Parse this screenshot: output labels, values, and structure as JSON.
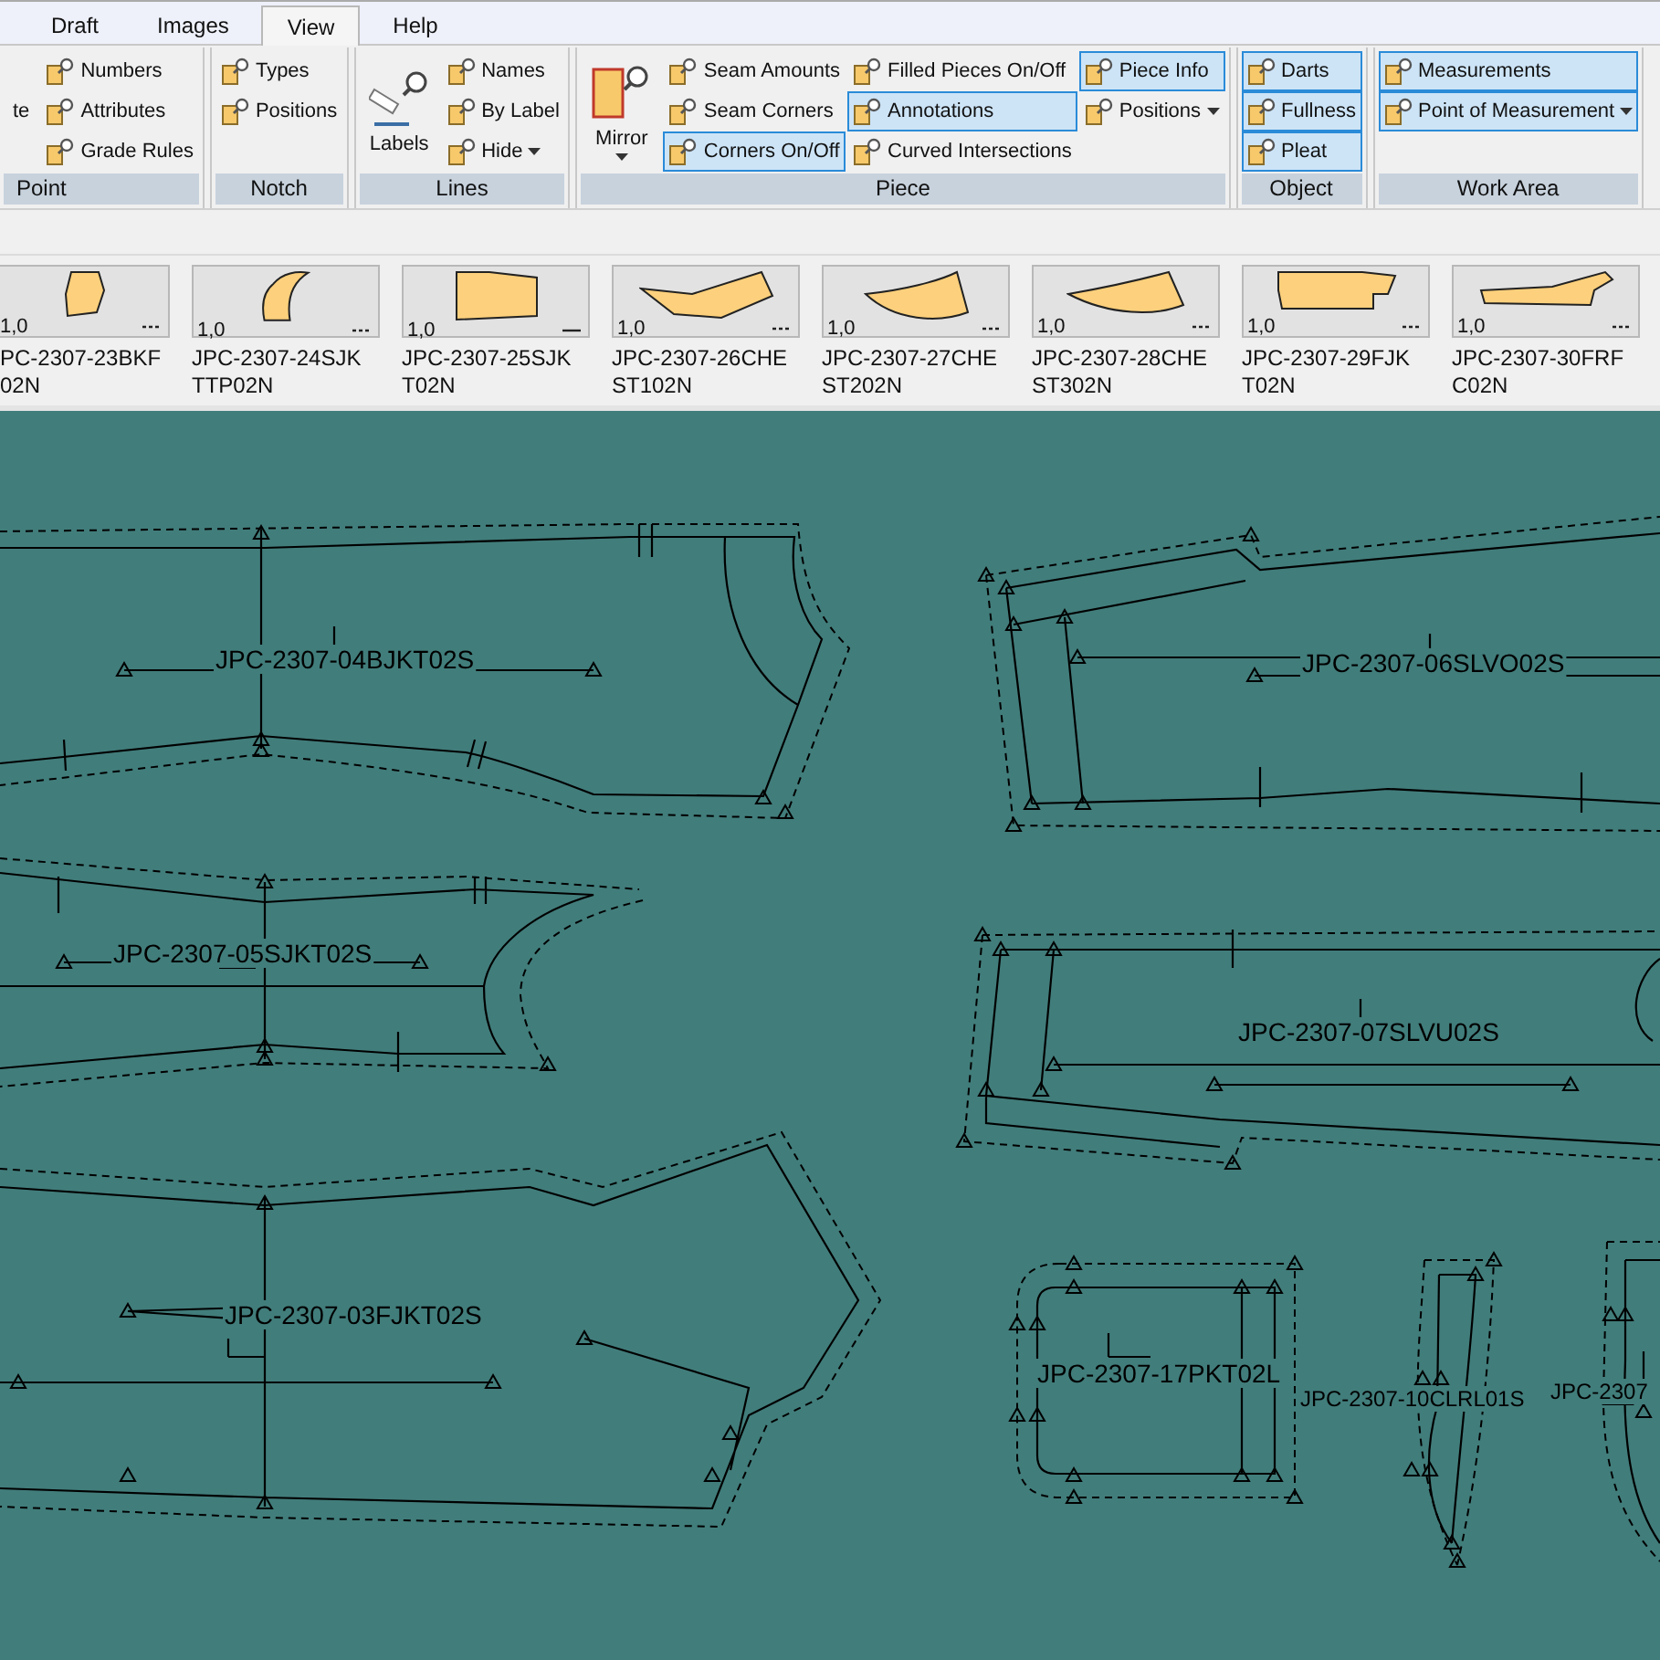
{
  "tabs": [
    {
      "label": "Draft",
      "selected": false
    },
    {
      "label": "Images",
      "selected": false
    },
    {
      "label": "View",
      "selected": true
    },
    {
      "label": "Help",
      "selected": false
    }
  ],
  "ribbon": {
    "groups": [
      {
        "title": "Point",
        "large": [
          {
            "label": "te",
            "kind": "text"
          }
        ],
        "columns": [
          [
            {
              "label": "Numbers",
              "kind": "button",
              "selected": false
            },
            {
              "label": "Attributes",
              "kind": "button",
              "selected": false
            },
            {
              "label": "Grade Rules",
              "kind": "button",
              "selected": false
            }
          ]
        ]
      },
      {
        "title": "Notch",
        "columns": [
          [
            {
              "label": "Types",
              "kind": "button",
              "selected": false
            },
            {
              "label": "Positions",
              "kind": "button",
              "selected": false
            }
          ]
        ]
      },
      {
        "title": "Lines",
        "large": [
          {
            "label": "Labels",
            "kind": "button"
          }
        ],
        "columns": [
          [
            {
              "label": "Names",
              "kind": "button",
              "selected": false
            },
            {
              "label": "By Label",
              "kind": "button",
              "selected": false
            },
            {
              "label": "Hide",
              "kind": "dropdown",
              "selected": false
            }
          ]
        ]
      },
      {
        "title": "Piece",
        "large": [
          {
            "label": "Mirror",
            "kind": "dropdown"
          }
        ],
        "columns": [
          [
            {
              "label": "Seam Amounts",
              "kind": "button",
              "selected": false
            },
            {
              "label": "Seam Corners",
              "kind": "button",
              "selected": false
            },
            {
              "label": "Corners On/Off",
              "kind": "button",
              "selected": true
            }
          ],
          [
            {
              "label": "Filled Pieces On/Off",
              "kind": "button",
              "selected": false
            },
            {
              "label": "Annotations",
              "kind": "button",
              "selected": true
            },
            {
              "label": "Curved Intersections",
              "kind": "button",
              "selected": false
            }
          ],
          [
            {
              "label": "Piece Info",
              "kind": "button",
              "selected": true
            },
            {
              "label": "Positions",
              "kind": "dropdown",
              "selected": false
            }
          ]
        ]
      },
      {
        "title": "Object",
        "columns": [
          [
            {
              "label": "Darts",
              "kind": "button",
              "selected": true
            },
            {
              "label": "Fullness",
              "kind": "button",
              "selected": true
            },
            {
              "label": "Pleat",
              "kind": "button",
              "selected": true
            }
          ]
        ]
      },
      {
        "title": "Work Area",
        "columns": [
          [
            {
              "label": "Measurements",
              "kind": "button",
              "selected": true
            },
            {
              "label": "Point of Measurement",
              "kind": "dropdown",
              "selected": true
            }
          ]
        ]
      }
    ]
  },
  "thumbnails": [
    {
      "scale": "1,0",
      "lines": [
        "PC-2307-23BKF",
        "02N"
      ],
      "kind": "dashed"
    },
    {
      "scale": "1,0",
      "lines": [
        "JPC-2307-24SJK",
        "TTP02N"
      ],
      "kind": "dashed"
    },
    {
      "scale": "1,0",
      "lines": [
        "JPC-2307-25SJK",
        "T02N"
      ],
      "kind": "solid"
    },
    {
      "scale": "1,0",
      "lines": [
        "JPC-2307-26CHE",
        "ST102N"
      ],
      "kind": "dashed"
    },
    {
      "scale": "1,0",
      "lines": [
        "JPC-2307-27CHE",
        "ST202N"
      ],
      "kind": "dashed"
    },
    {
      "scale": "1,0",
      "lines": [
        "JPC-2307-28CHE",
        "ST302N"
      ],
      "kind": "dashed"
    },
    {
      "scale": "1,0",
      "lines": [
        "JPC-2307-29FJK",
        "T02N"
      ],
      "kind": "dashed"
    },
    {
      "scale": "1,0",
      "lines": [
        "JPC-2307-30FRF",
        "C02N"
      ],
      "kind": "dashed"
    }
  ],
  "canvas": {
    "pieces": [
      {
        "label": "JPC-2307-04BJKT02S"
      },
      {
        "label": "JPC-2307-06SLVO02S"
      },
      {
        "label": "JPC-2307-05SJKT02S"
      },
      {
        "label": "JPC-2307-07SLVU02S"
      },
      {
        "label": "JPC-2307-03FJKT02S"
      },
      {
        "label": "JPC-2307-17PKT02L"
      },
      {
        "label": "JPC-2307-10CLRL01S"
      },
      {
        "label": "JPC-2307"
      }
    ]
  }
}
